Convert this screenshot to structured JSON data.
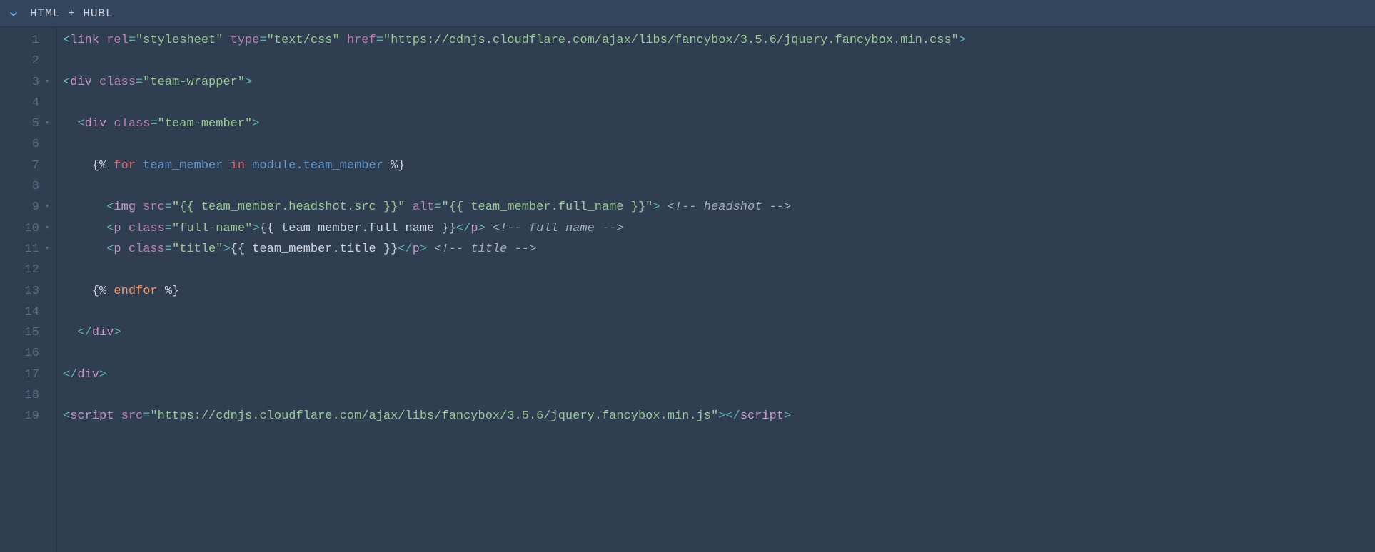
{
  "header": {
    "language_label": "HTML + HUBL"
  },
  "gutter": {
    "fold_lines": [
      3,
      5,
      9,
      10,
      11
    ],
    "lines": [
      "1",
      "2",
      "3",
      "4",
      "5",
      "6",
      "7",
      "8",
      "9",
      "10",
      "11",
      "12",
      "13",
      "14",
      "15",
      "16",
      "17",
      "18",
      "19"
    ]
  },
  "code": {
    "lines": [
      [
        {
          "cls": "punct",
          "t": "<"
        },
        {
          "cls": "tag",
          "t": "link"
        },
        {
          "cls": "plain",
          "t": " "
        },
        {
          "cls": "attr",
          "t": "rel"
        },
        {
          "cls": "punct",
          "t": "="
        },
        {
          "cls": "str",
          "t": "\"stylesheet\""
        },
        {
          "cls": "plain",
          "t": " "
        },
        {
          "cls": "attr",
          "t": "type"
        },
        {
          "cls": "punct",
          "t": "="
        },
        {
          "cls": "str",
          "t": "\"text/css\""
        },
        {
          "cls": "plain",
          "t": " "
        },
        {
          "cls": "attr",
          "t": "href"
        },
        {
          "cls": "punct",
          "t": "="
        },
        {
          "cls": "str",
          "t": "\"https://cdnjs.cloudflare.com/ajax/libs/fancybox/3.5.6/jquery.fancybox.min.css\""
        },
        {
          "cls": "punct",
          "t": ">"
        }
      ],
      [],
      [
        {
          "cls": "punct",
          "t": "<"
        },
        {
          "cls": "tag",
          "t": "div"
        },
        {
          "cls": "plain",
          "t": " "
        },
        {
          "cls": "attr",
          "t": "class"
        },
        {
          "cls": "punct",
          "t": "="
        },
        {
          "cls": "str",
          "t": "\"team-wrapper\""
        },
        {
          "cls": "punct",
          "t": ">"
        }
      ],
      [],
      [
        {
          "cls": "plain",
          "t": "  "
        },
        {
          "cls": "punct",
          "t": "<"
        },
        {
          "cls": "tag",
          "t": "div"
        },
        {
          "cls": "plain",
          "t": " "
        },
        {
          "cls": "attr",
          "t": "class"
        },
        {
          "cls": "punct",
          "t": "="
        },
        {
          "cls": "str",
          "t": "\"team-member\""
        },
        {
          "cls": "punct",
          "t": ">"
        }
      ],
      [],
      [
        {
          "cls": "plain",
          "t": "    {% "
        },
        {
          "cls": "kw",
          "t": "for"
        },
        {
          "cls": "plain",
          "t": " "
        },
        {
          "cls": "var",
          "t": "team_member"
        },
        {
          "cls": "plain",
          "t": " "
        },
        {
          "cls": "kw",
          "t": "in"
        },
        {
          "cls": "plain",
          "t": " "
        },
        {
          "cls": "var",
          "t": "module.team_member"
        },
        {
          "cls": "plain",
          "t": " %}"
        }
      ],
      [],
      [
        {
          "cls": "plain",
          "t": "      "
        },
        {
          "cls": "punct",
          "t": "<"
        },
        {
          "cls": "tag",
          "t": "img"
        },
        {
          "cls": "plain",
          "t": " "
        },
        {
          "cls": "attr",
          "t": "src"
        },
        {
          "cls": "punct",
          "t": "="
        },
        {
          "cls": "str",
          "t": "\"{{ team_member.headshot.src }}\""
        },
        {
          "cls": "plain",
          "t": " "
        },
        {
          "cls": "attr",
          "t": "alt"
        },
        {
          "cls": "punct",
          "t": "="
        },
        {
          "cls": "str",
          "t": "\"{{ team_member.full_name }}\""
        },
        {
          "cls": "punct",
          "t": ">"
        },
        {
          "cls": "plain",
          "t": " "
        },
        {
          "cls": "comment",
          "t": "<!-- headshot -->"
        }
      ],
      [
        {
          "cls": "plain",
          "t": "      "
        },
        {
          "cls": "punct",
          "t": "<"
        },
        {
          "cls": "tag",
          "t": "p"
        },
        {
          "cls": "plain",
          "t": " "
        },
        {
          "cls": "attr",
          "t": "class"
        },
        {
          "cls": "punct",
          "t": "="
        },
        {
          "cls": "str",
          "t": "\"full-name\""
        },
        {
          "cls": "punct",
          "t": ">"
        },
        {
          "cls": "plain",
          "t": "{{ team_member.full_name }}"
        },
        {
          "cls": "punct",
          "t": "</"
        },
        {
          "cls": "tag",
          "t": "p"
        },
        {
          "cls": "punct",
          "t": ">"
        },
        {
          "cls": "plain",
          "t": " "
        },
        {
          "cls": "comment",
          "t": "<!-- full name -->"
        }
      ],
      [
        {
          "cls": "plain",
          "t": "      "
        },
        {
          "cls": "punct",
          "t": "<"
        },
        {
          "cls": "tag",
          "t": "p"
        },
        {
          "cls": "plain",
          "t": " "
        },
        {
          "cls": "attr",
          "t": "class"
        },
        {
          "cls": "punct",
          "t": "="
        },
        {
          "cls": "str",
          "t": "\"title\""
        },
        {
          "cls": "punct",
          "t": ">"
        },
        {
          "cls": "plain",
          "t": "{{ team_member.title }}"
        },
        {
          "cls": "punct",
          "t": "</"
        },
        {
          "cls": "tag",
          "t": "p"
        },
        {
          "cls": "punct",
          "t": ">"
        },
        {
          "cls": "plain",
          "t": " "
        },
        {
          "cls": "comment",
          "t": "<!-- title -->"
        }
      ],
      [],
      [
        {
          "cls": "plain",
          "t": "    {% "
        },
        {
          "cls": "kw2",
          "t": "endfor"
        },
        {
          "cls": "plain",
          "t": " %}"
        }
      ],
      [],
      [
        {
          "cls": "plain",
          "t": "  "
        },
        {
          "cls": "punct",
          "t": "</"
        },
        {
          "cls": "tag",
          "t": "div"
        },
        {
          "cls": "punct",
          "t": ">"
        }
      ],
      [],
      [
        {
          "cls": "punct",
          "t": "</"
        },
        {
          "cls": "tag",
          "t": "div"
        },
        {
          "cls": "punct",
          "t": ">"
        }
      ],
      [],
      [
        {
          "cls": "punct",
          "t": "<"
        },
        {
          "cls": "tag",
          "t": "script"
        },
        {
          "cls": "plain",
          "t": " "
        },
        {
          "cls": "attr",
          "t": "src"
        },
        {
          "cls": "punct",
          "t": "="
        },
        {
          "cls": "str",
          "t": "\"https://cdnjs.cloudflare.com/ajax/libs/fancybox/3.5.6/jquery.fancybox.min.js\""
        },
        {
          "cls": "punct",
          "t": ">"
        },
        {
          "cls": "punct",
          "t": "</"
        },
        {
          "cls": "tag",
          "t": "script"
        },
        {
          "cls": "punct",
          "t": ">"
        }
      ]
    ]
  }
}
